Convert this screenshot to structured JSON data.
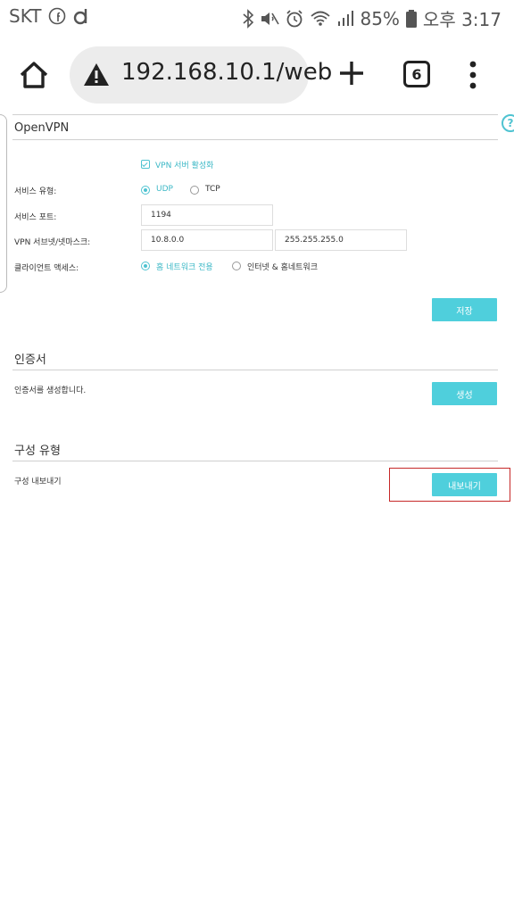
{
  "status_bar": {
    "carrier": "SKT",
    "battery": "85%",
    "time": "오후 3:17",
    "icons": [
      "facebook-icon",
      "d-app-icon",
      "bluetooth-icon",
      "mute-icon",
      "alarm-icon",
      "wifi-icon",
      "signal-icon",
      "battery-icon"
    ]
  },
  "browser": {
    "url": "192.168.10.1/web",
    "tab_count": "6"
  },
  "openvpn": {
    "title": "OpenVPN",
    "enable_label": "VPN 서버 활성화",
    "enable_checked": true,
    "service_type_label": "서비스 유형:",
    "service_type_options": [
      "UDP",
      "TCP"
    ],
    "service_type_selected": "UDP",
    "service_port_label": "서비스 포트:",
    "service_port_value": "1194",
    "subnet_label": "VPN 서브넷/넷마스크:",
    "subnet_value": "10.8.0.0",
    "netmask_value": "255.255.255.0",
    "client_access_label": "클라이언트 액세스:",
    "client_access_options": [
      "홈 네트워크 전용",
      "인터넷 & 홈네트워크"
    ],
    "client_access_selected": "홈 네트워크 전용",
    "save_button": "저장"
  },
  "certificate": {
    "title": "인증서",
    "description": "인증서를 생성합니다.",
    "generate_button": "생성"
  },
  "config": {
    "title": "구성 유형",
    "description": "구성 내보내기",
    "export_button": "내보내기"
  },
  "colors": {
    "accent": "#4fcfdc",
    "highlight": "#c62828"
  }
}
